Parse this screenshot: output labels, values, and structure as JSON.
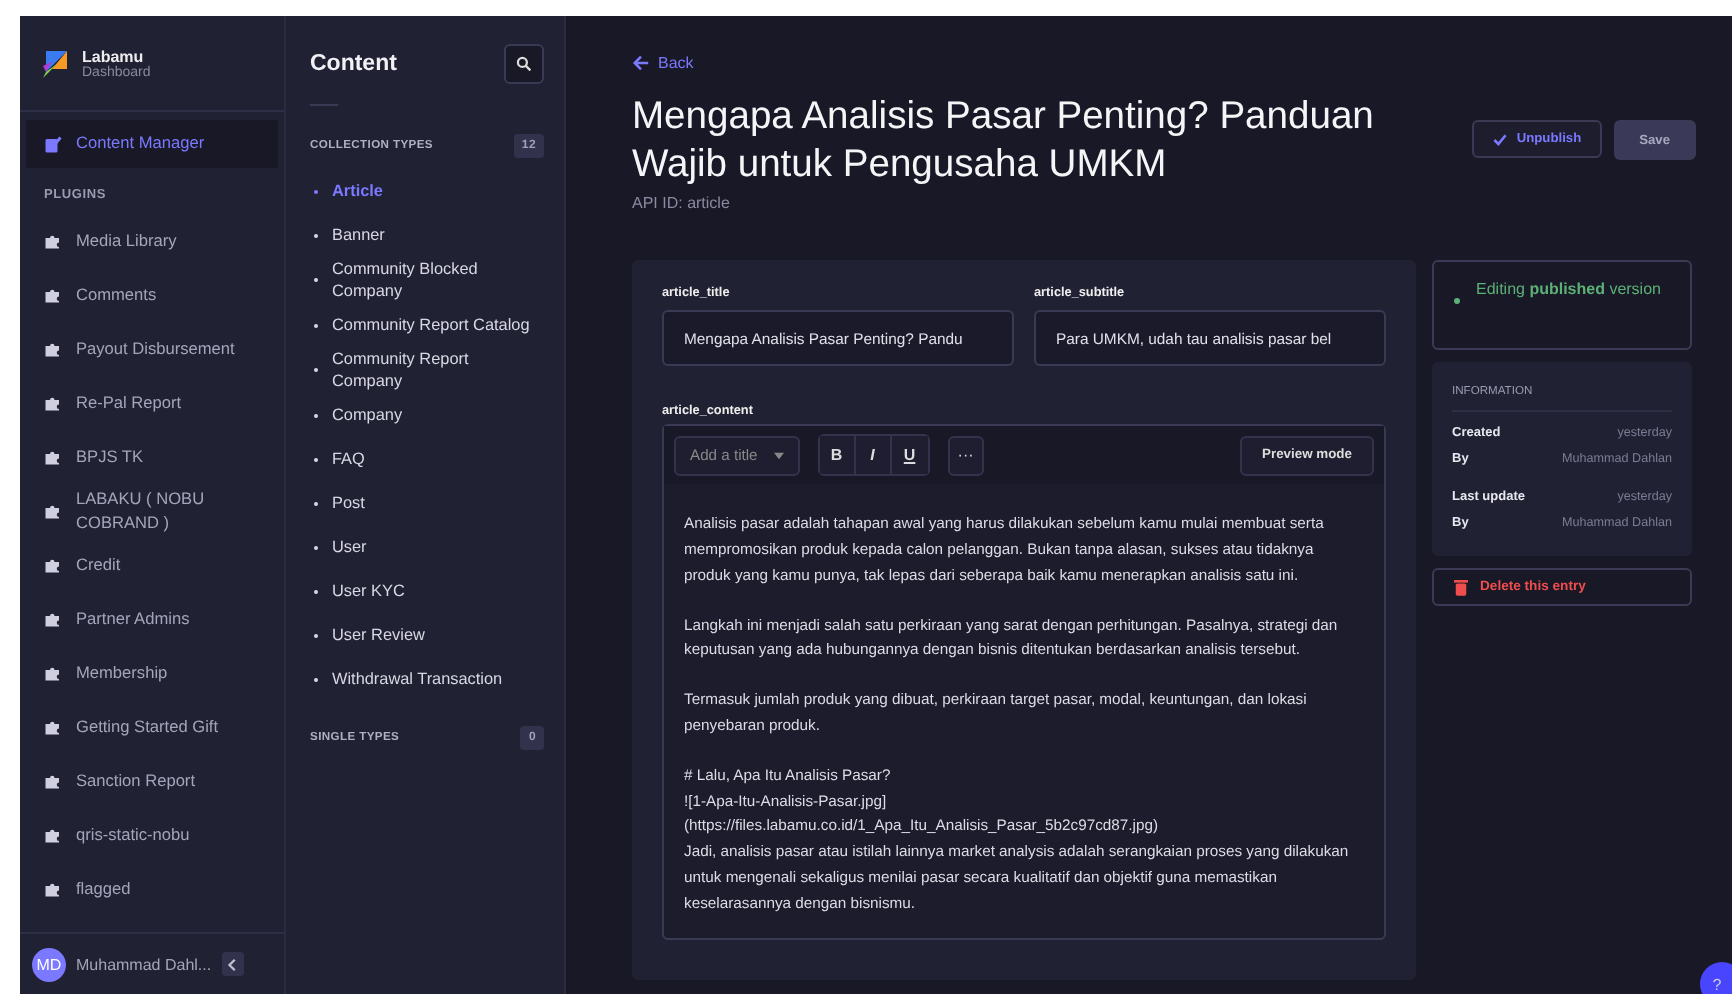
{
  "brand": {
    "name": "Labamu",
    "subtitle": "Dashboard"
  },
  "sidebar": {
    "top_items": [
      {
        "label": "Content Manager",
        "selected": true
      }
    ],
    "plugins_heading": "PLUGINS",
    "plugins": [
      {
        "label": "Media Library",
        "selected": false
      },
      {
        "label": "Comments",
        "selected": false
      },
      {
        "label": "Payout Disbursement",
        "selected": false
      },
      {
        "label": "Re-Pal Report",
        "selected": false
      },
      {
        "label": "BPJS TK",
        "selected": false
      },
      {
        "label": "LABAKU ( NOBU COBRAND )",
        "selected": false
      },
      {
        "label": "Credit",
        "selected": false
      },
      {
        "label": "Partner Admins",
        "selected": false
      },
      {
        "label": "Membership",
        "selected": false
      },
      {
        "label": "Getting Started Gift",
        "selected": false
      },
      {
        "label": "Sanction Report",
        "selected": false
      },
      {
        "label": "qris-static-nobu",
        "selected": false
      },
      {
        "label": "flagged",
        "selected": false
      }
    ],
    "user": {
      "initials": "MD",
      "name": "Muhammad Dahl..."
    }
  },
  "content_nav": {
    "title": "Content",
    "collection_heading": "COLLECTION TYPES",
    "collection_count": "12",
    "collection_types": [
      {
        "label": "Article",
        "selected": true
      },
      {
        "label": "Banner",
        "selected": false
      },
      {
        "label": "Community Blocked Company",
        "selected": false
      },
      {
        "label": "Community Report Catalog",
        "selected": false
      },
      {
        "label": "Community Report Company",
        "selected": false
      },
      {
        "label": "Company",
        "selected": false
      },
      {
        "label": "FAQ",
        "selected": false
      },
      {
        "label": "Post",
        "selected": false
      },
      {
        "label": "User",
        "selected": false
      },
      {
        "label": "User KYC",
        "selected": false
      },
      {
        "label": "User Review",
        "selected": false
      },
      {
        "label": "Withdrawal Transaction",
        "selected": false
      }
    ],
    "single_heading": "SINGLE TYPES",
    "single_count": "0"
  },
  "main": {
    "back": "Back",
    "title": "Mengapa Analisis Pasar Penting? Panduan Wajib untuk Pengusaha UMKM",
    "api_id": "API ID: article",
    "unpublish": "Unpublish",
    "save": "Save",
    "fields": [
      {
        "label": "article_title",
        "value": "Mengapa Analisis Pasar Penting? Pandu"
      },
      {
        "label": "article_subtitle",
        "value": "Para UMKM, udah tau analisis pasar bel"
      }
    ],
    "editor": {
      "label": "article_content",
      "heading_placeholder": "Add a title",
      "format_buttons": [
        "B",
        "I",
        "U"
      ],
      "more": "···",
      "preview": "Preview mode",
      "paragraphs": [
        "Analisis pasar adalah tahapan awal yang harus dilakukan sebelum kamu mulai membuat serta mempromosikan produk kepada calon pelanggan. Bukan tanpa alasan, sukses atau tidaknya produk yang kamu punya, tak lepas dari seberapa baik kamu menerapkan analisis satu ini.",
        "Langkah ini menjadi salah satu perkiraan yang sarat dengan perhitungan. Pasalnya, strategi dan keputusan yang ada hubungannya dengan bisnis ditentukan berdasarkan analisis tersebut.",
        "Termasuk jumlah produk yang dibuat, perkiraan target pasar, modal, keuntungan, dan lokasi penyebaran produk.",
        "# Lalu, Apa Itu Analisis Pasar?\n![1-Apa-Itu-Analisis-Pasar.jpg]\n(https://files.labamu.co.id/1_Apa_Itu_Analisis_Pasar_5b2c97cd87.jpg)\nJadi, analisis pasar atau istilah lainnya market analysis adalah serangkaian proses yang dilakukan untuk mengenali sekaligus menilai pasar secara kualitatif dan objektif guna memastikan keselarasannya dengan bisnismu."
      ]
    }
  },
  "panel": {
    "status": {
      "text": "Editing **published** version",
      "color": "#5cb176"
    },
    "info_heading": "INFORMATION",
    "info_groups": [
      [
        {
          "label": "Created",
          "value": "yesterday"
        },
        {
          "label": "By",
          "value": "Muhammad Dahlan"
        }
      ],
      [
        {
          "label": "Last update",
          "value": "yesterday"
        },
        {
          "label": "By",
          "value": "Muhammad Dahlan"
        }
      ]
    ],
    "delete": "Delete this entry"
  },
  "help": "?"
}
